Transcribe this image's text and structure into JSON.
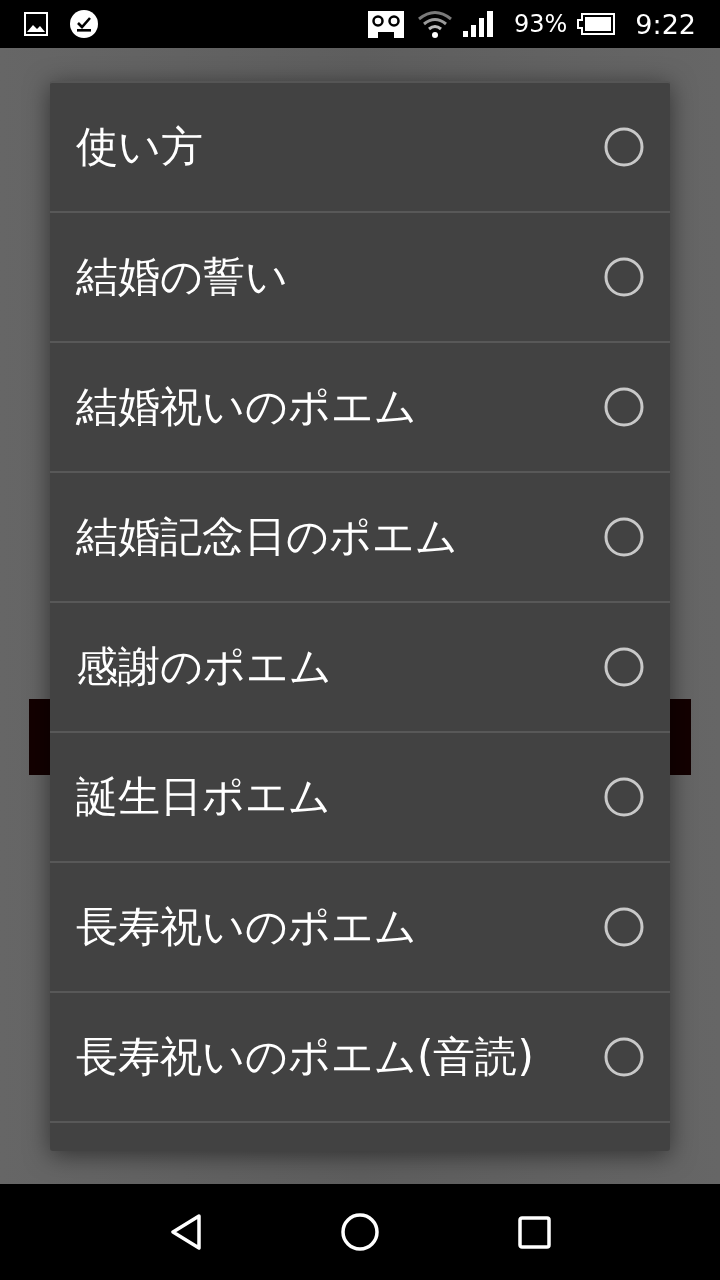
{
  "status_bar": {
    "battery": "93%",
    "time": "9:22"
  },
  "dialog": {
    "items": [
      {
        "label": "使い方",
        "selected": false
      },
      {
        "label": "結婚の誓い",
        "selected": false
      },
      {
        "label": "結婚祝いのポエム",
        "selected": false
      },
      {
        "label": "結婚記念日のポエム",
        "selected": false
      },
      {
        "label": "感謝のポエム",
        "selected": false
      },
      {
        "label": "誕生日ポエム",
        "selected": false
      },
      {
        "label": "長寿祝いのポエム",
        "selected": false
      },
      {
        "label": "長寿祝いのポエム(音読)",
        "selected": false
      }
    ]
  }
}
